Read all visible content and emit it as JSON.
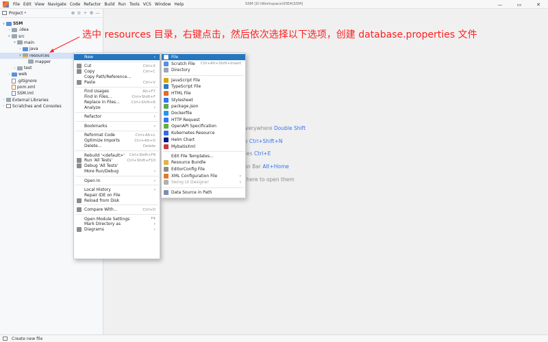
{
  "window": {
    "title": "SSM [D:\\Workspace\\IDEA\\SSM]",
    "minimize": "—",
    "maximize": "▭",
    "close": "✕"
  },
  "menubar": {
    "items": [
      "File",
      "Edit",
      "View",
      "Navigate",
      "Code",
      "Refactor",
      "Build",
      "Run",
      "Tools",
      "VCS",
      "Window",
      "Help"
    ]
  },
  "project_panel": {
    "title": "Project",
    "caret": "▾",
    "tools": [
      "⊕",
      "≡",
      "÷",
      "⚙",
      "—"
    ],
    "tree": [
      {
        "label": "SSM",
        "level": 0,
        "expanded": true,
        "icon": "folder-blue",
        "bold": true
      },
      {
        "label": ".idea",
        "level": 1,
        "expanded": false,
        "icon": "folder-grey"
      },
      {
        "label": "src",
        "level": 1,
        "expanded": true,
        "icon": "folder-grey"
      },
      {
        "label": "main",
        "level": 2,
        "expanded": true,
        "icon": "folder-grey"
      },
      {
        "label": "java",
        "level": 3,
        "expanded": false,
        "icon": "folder-blue"
      },
      {
        "label": "resources",
        "level": 3,
        "expanded": true,
        "icon": "folder-resources",
        "selected": true
      },
      {
        "label": "mapper",
        "level": 4,
        "icon": "folder-grey"
      },
      {
        "label": "test",
        "level": 2,
        "expanded": false,
        "icon": "folder-grey"
      },
      {
        "label": "web",
        "level": 1,
        "expanded": false,
        "icon": "folder-blue"
      },
      {
        "label": ".gitignore",
        "level": 1,
        "icon": "file"
      },
      {
        "label": "pom.xml",
        "level": 1,
        "icon": "file-xml"
      },
      {
        "label": "SSM.iml",
        "level": 1,
        "icon": "file-iml"
      },
      {
        "label": "External Libraries",
        "level": 0,
        "expanded": false,
        "icon": "library"
      },
      {
        "label": "Scratches and Consoles",
        "level": 0,
        "expanded": false,
        "icon": "console"
      }
    ]
  },
  "annotation": {
    "text": "选中 resources 目录，右键点击，然后依次选择以下选项，创建 database.properties 文件",
    "marker_1": "①",
    "marker_2": "②",
    "color": "#ff1f1f"
  },
  "context_menu": {
    "items": [
      {
        "type": "item",
        "label": "New",
        "submenu": true,
        "active": true
      },
      {
        "type": "sep"
      },
      {
        "type": "item",
        "label": "Cut",
        "shortcut": "Ctrl+X",
        "icon": "cut-icon"
      },
      {
        "type": "item",
        "label": "Copy",
        "shortcut": "Ctrl+C",
        "icon": "copy-icon"
      },
      {
        "type": "item",
        "label": "Copy Path/Reference..."
      },
      {
        "type": "item",
        "label": "Paste",
        "shortcut": "Ctrl+V",
        "icon": "paste-icon"
      },
      {
        "type": "sep"
      },
      {
        "type": "item",
        "label": "Find Usages",
        "shortcut": "Alt+F7"
      },
      {
        "type": "item",
        "label": "Find in Files...",
        "shortcut": "Ctrl+Shift+F"
      },
      {
        "type": "item",
        "label": "Replace in Files...",
        "shortcut": "Ctrl+Shift+R"
      },
      {
        "type": "item",
        "label": "Analyze",
        "submenu": true
      },
      {
        "type": "sep"
      },
      {
        "type": "item",
        "label": "Refactor",
        "submenu": true
      },
      {
        "type": "sep"
      },
      {
        "type": "item",
        "label": "Bookmarks",
        "submenu": true
      },
      {
        "type": "sep"
      },
      {
        "type": "item",
        "label": "Reformat Code",
        "shortcut": "Ctrl+Alt+L"
      },
      {
        "type": "item",
        "label": "Optimize Imports",
        "shortcut": "Ctrl+Alt+O"
      },
      {
        "type": "item",
        "label": "Delete...",
        "shortcut": "Delete"
      },
      {
        "type": "sep"
      },
      {
        "type": "item",
        "label": "Rebuild '<default>'",
        "shortcut": "Ctrl+Shift+F9"
      },
      {
        "type": "item",
        "label": "Run 'All Tests'",
        "shortcut": "Ctrl+Shift+F10",
        "icon": "run-icon"
      },
      {
        "type": "item",
        "label": "Debug 'All Tests'",
        "icon": "debug-icon"
      },
      {
        "type": "item",
        "label": "More Run/Debug",
        "submenu": true
      },
      {
        "type": "sep"
      },
      {
        "type": "item",
        "label": "Open In",
        "submenu": true
      },
      {
        "type": "sep"
      },
      {
        "type": "item",
        "label": "Local History",
        "submenu": true
      },
      {
        "type": "item",
        "label": "Repair IDE on File"
      },
      {
        "type": "item",
        "label": "Reload from Disk",
        "icon": "reload-icon"
      },
      {
        "type": "sep"
      },
      {
        "type": "item",
        "label": "Compare With...",
        "shortcut": "Ctrl+D",
        "icon": "compare-icon"
      },
      {
        "type": "sep"
      },
      {
        "type": "item",
        "label": "Open Module Settings",
        "shortcut": "F4"
      },
      {
        "type": "item",
        "label": "Mark Directory as",
        "submenu": true
      },
      {
        "type": "item",
        "label": "Diagrams",
        "submenu": true,
        "icon": "diagram-icon"
      }
    ]
  },
  "new_submenu": {
    "items": [
      {
        "type": "item",
        "label": "File",
        "active": true,
        "icon": "file-icon",
        "color": "#ffffff"
      },
      {
        "type": "item",
        "label": "Scratch File",
        "shortcut": "Ctrl+Alt+Shift+Insert",
        "icon": "scratch-file-icon",
        "color": "#5c8fd6"
      },
      {
        "type": "item",
        "label": "Directory",
        "icon": "folder-icon",
        "color": "#9aa7b0"
      },
      {
        "type": "sep"
      },
      {
        "type": "item",
        "label": "JavaScript File",
        "icon": "javascript-icon",
        "color": "#d6a500"
      },
      {
        "type": "item",
        "label": "TypeScript File",
        "icon": "typescript-icon",
        "color": "#3178c6"
      },
      {
        "type": "item",
        "label": "HTML File",
        "icon": "html-icon",
        "color": "#e06c2a"
      },
      {
        "type": "item",
        "label": "Stylesheet",
        "icon": "css-icon",
        "color": "#3574f0"
      },
      {
        "type": "item",
        "label": "package.json",
        "icon": "npm-icon",
        "color": "#5fa84a"
      },
      {
        "type": "item",
        "label": "Dockerfile",
        "icon": "docker-icon",
        "color": "#2496ed"
      },
      {
        "type": "item",
        "label": "HTTP Request",
        "icon": "http-icon",
        "color": "#3574f0"
      },
      {
        "type": "item",
        "label": "OpenAPI Specification",
        "icon": "openapi-icon",
        "color": "#6aab3c"
      },
      {
        "type": "item",
        "label": "Kubernetes Resource",
        "icon": "kubernetes-icon",
        "color": "#326ce5"
      },
      {
        "type": "item",
        "label": "Helm Chart",
        "icon": "helm-icon",
        "color": "#0f1689"
      },
      {
        "type": "item",
        "label": "MybatisXml",
        "icon": "mybatis-icon",
        "color": "#c83a3a"
      },
      {
        "type": "sep"
      },
      {
        "type": "item",
        "label": "Edit File Templates..."
      },
      {
        "type": "item",
        "label": "Resource Bundle",
        "icon": "resource-bundle-icon",
        "color": "#e0b34b"
      },
      {
        "type": "item",
        "label": "EditorConfig File",
        "icon": "editorconfig-icon",
        "color": "#8c8c8c"
      },
      {
        "type": "item",
        "label": "XML Configuration File",
        "submenu": true,
        "icon": "xml-icon",
        "color": "#e07b2a"
      },
      {
        "type": "item",
        "label": "Swing UI Designer",
        "submenu": true,
        "disabled": true,
        "icon": "swing-icon",
        "color": "#b0b0b0"
      },
      {
        "type": "sep"
      },
      {
        "type": "item",
        "label": "Data Source in Path",
        "icon": "database-icon",
        "color": "#7a8fb0"
      }
    ]
  },
  "editor_hints": [
    {
      "text": "ch Everywhere",
      "shortcut": "Double Shift"
    },
    {
      "text": "o File",
      "shortcut": "Ctrl+Shift+N"
    },
    {
      "text": "nt Files",
      "shortcut": "Ctrl+E"
    },
    {
      "text": "gation Bar",
      "shortcut": "Alt+Home"
    },
    {
      "text": "files here to open them",
      "shortcut": ""
    }
  ],
  "statusbar": {
    "text": "Create new file"
  }
}
